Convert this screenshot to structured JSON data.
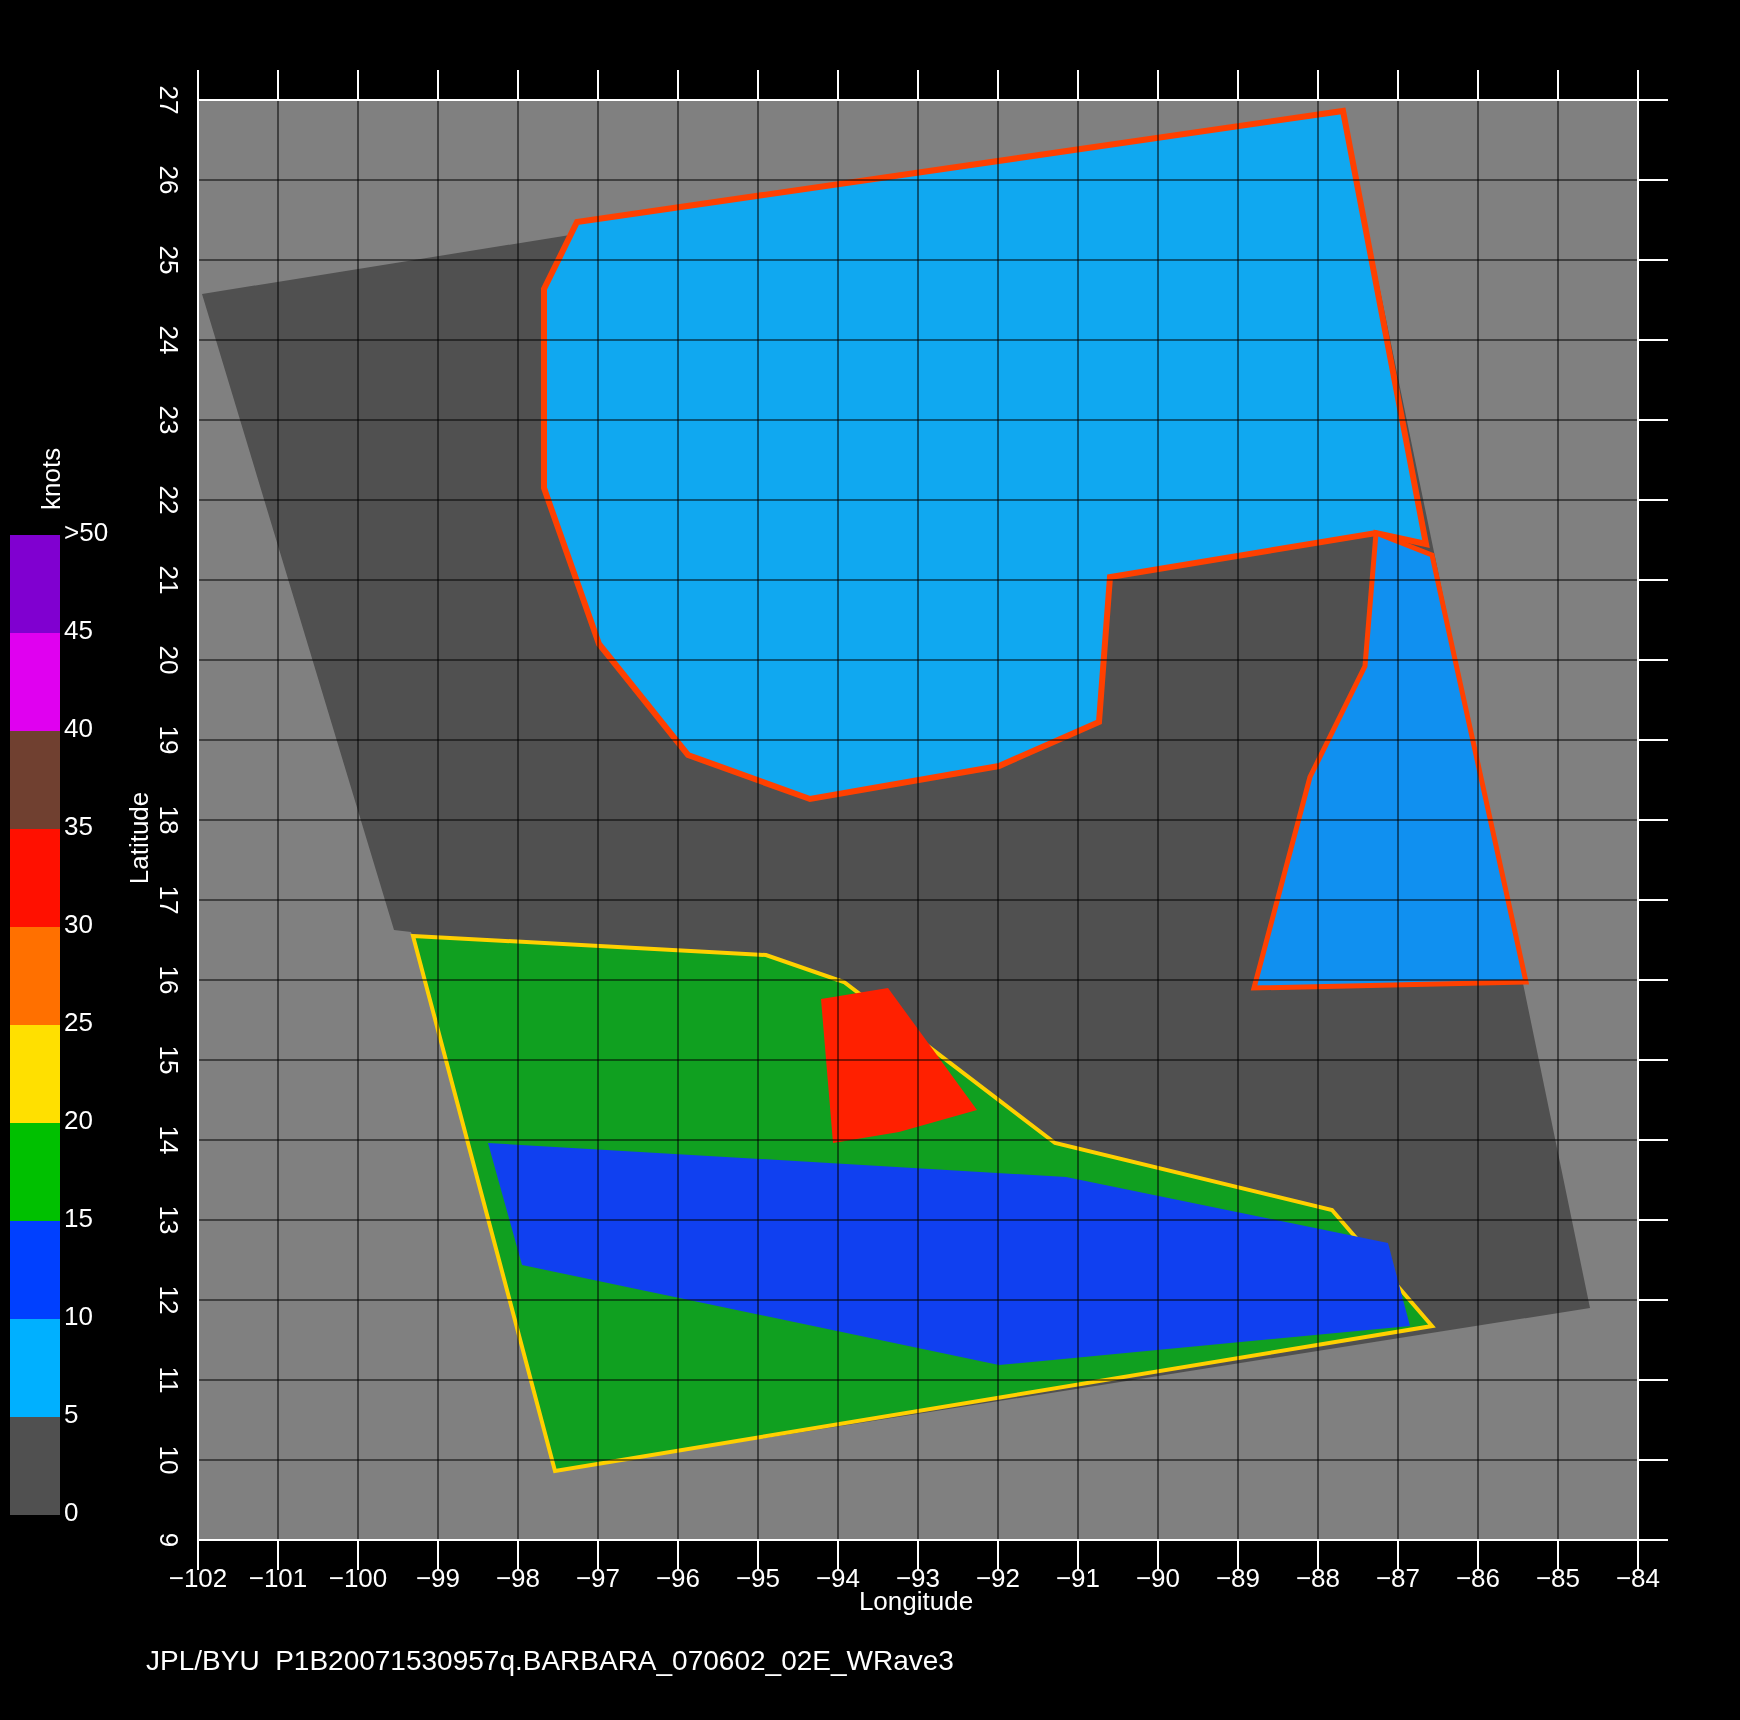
{
  "plot": {
    "xlabel": "Longitude",
    "ylabel": "Latitude",
    "xticks": [
      "−102",
      "−101",
      "−100",
      "−99",
      "−98",
      "−97",
      "−96",
      "−95",
      "−94",
      "−93",
      "−92",
      "−91",
      "−90",
      "−89",
      "−88",
      "−87",
      "−86",
      "−85",
      "−84"
    ],
    "yticks": [
      "9",
      "10",
      "11",
      "12",
      "13",
      "14",
      "15",
      "16",
      "17",
      "18",
      "19",
      "20",
      "21",
      "22",
      "23",
      "24",
      "25",
      "26",
      "27"
    ]
  },
  "colorbar": {
    "unit": "knots",
    "labels": [
      ">50",
      "45",
      "40",
      "35",
      "30",
      "25",
      "20",
      "15",
      "10",
      "5",
      "0"
    ],
    "bands": [
      {
        "color": "#8000d0"
      },
      {
        "color": "#e000f0"
      },
      {
        "color": "#704030"
      },
      {
        "color": "#ff1000"
      },
      {
        "color": "#ff7000"
      },
      {
        "color": "#ffe000"
      },
      {
        "color": "#00c000"
      },
      {
        "color": "#0040ff"
      },
      {
        "color": "#00b0ff"
      },
      {
        "color": "#505050"
      }
    ]
  },
  "footer": "JPL/BYU  P1B20071530957q.BARBARA_070602_02E_WRave3"
}
